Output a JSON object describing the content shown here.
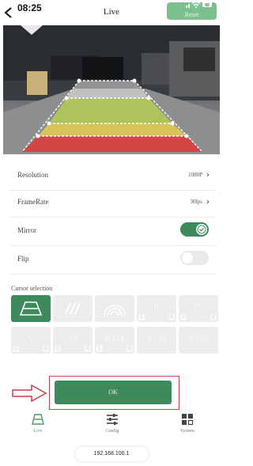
{
  "status_bar": {
    "time": "08:25"
  },
  "header": {
    "title": "Live",
    "reset_label": "Reset"
  },
  "settings": {
    "resolution": {
      "label": "Resolution",
      "value": "1080P"
    },
    "framerate": {
      "label": "FrameRate",
      "value": "30fps"
    },
    "mirror": {
      "label": "Mirror",
      "enabled": true
    },
    "flip": {
      "label": "Flip",
      "enabled": false
    }
  },
  "cursor_selection": {
    "label": "Cursor selection",
    "items": [
      {
        "id": "cursor-1",
        "text": "",
        "selected": true
      },
      {
        "id": "cursor-2",
        "text": "",
        "selected": false
      },
      {
        "id": "cursor-3",
        "text": "",
        "selected": false
      },
      {
        "id": "cursor-ii",
        "text": "II",
        "badge_left": "L",
        "badge_right": "R"
      },
      {
        "id": "cursor-iv",
        "text": "IV",
        "badge_left": "L",
        "badge_right": "R"
      },
      {
        "id": "cursor-v",
        "text": "V",
        "badge_left": "L",
        "badge_right": "R"
      },
      {
        "id": "cursor-vi",
        "text": "VI",
        "badge_left": "L",
        "badge_right": "R"
      },
      {
        "id": "cursor-r151",
        "text": "R151",
        "badge_left": "L",
        "badge_right": "R"
      },
      {
        "id": "cursor-r158",
        "text": "R158"
      },
      {
        "id": "cursor-r159",
        "text": "R159"
      }
    ]
  },
  "ok_label": "OK",
  "nav": {
    "live": "Live",
    "config": "Config",
    "system": "System"
  },
  "ip_address": "192.168.100.1",
  "colors": {
    "accent": "#3f8a5c",
    "highlight_frame": "#d03a4a",
    "inactive_cell": "#ececec"
  }
}
